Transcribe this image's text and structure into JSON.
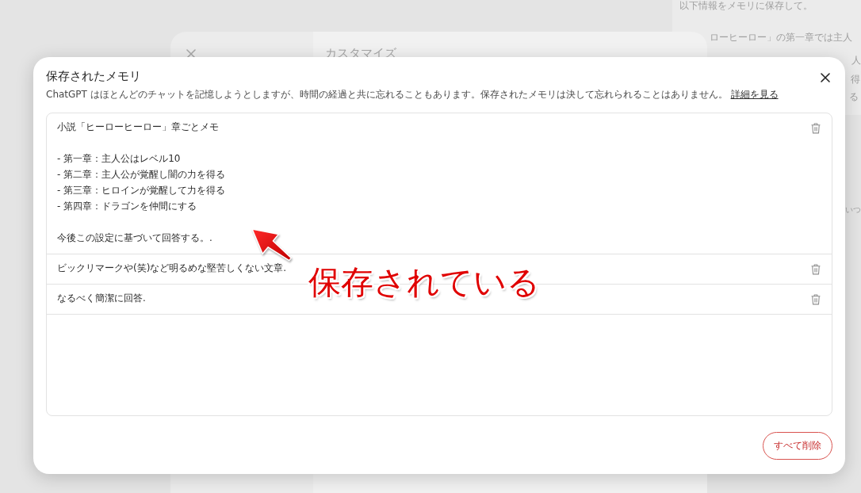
{
  "background": {
    "customize_dialog": {
      "title": "カスタマイズ"
    },
    "message": {
      "lines": [
        "以下情報をメモリに保存して。",
        "ローヒーロー」の第一章では主人",
        "人",
        "得",
        "る"
      ]
    },
    "reply": {
      "text": "いつ"
    }
  },
  "modal": {
    "title": "保存されたメモリ",
    "description": "ChatGPT はほとんどのチャットを記憶しようとしますが、時間の経過と共に忘れることもあります。保存されたメモリは決して忘れられることはありません。",
    "link": "詳細を見る",
    "memories": [
      {
        "paragraphs": [
          {
            "lines": [
              "小説「ヒーローヒーロー」章ごとメモ"
            ]
          },
          {
            "lines": [
              "- 第一章：主人公はレベル10",
              "- 第二章：主人公が覚醒し闇の力を得る",
              "- 第三章：ヒロインが覚醒して力を得る",
              "- 第四章：ドラゴンを仲間にする"
            ]
          },
          {
            "lines": [
              "今後この設定に基づいて回答する。."
            ]
          }
        ]
      },
      {
        "paragraphs": [
          {
            "lines": [
              "ビックリマークや(笑)など明るめな堅苦しくない文章."
            ]
          }
        ]
      },
      {
        "paragraphs": [
          {
            "lines": [
              "なるべく簡潔に回答."
            ]
          }
        ]
      }
    ],
    "delete_all_button": "すべて削除"
  },
  "annotation": {
    "text": "保存されている"
  }
}
